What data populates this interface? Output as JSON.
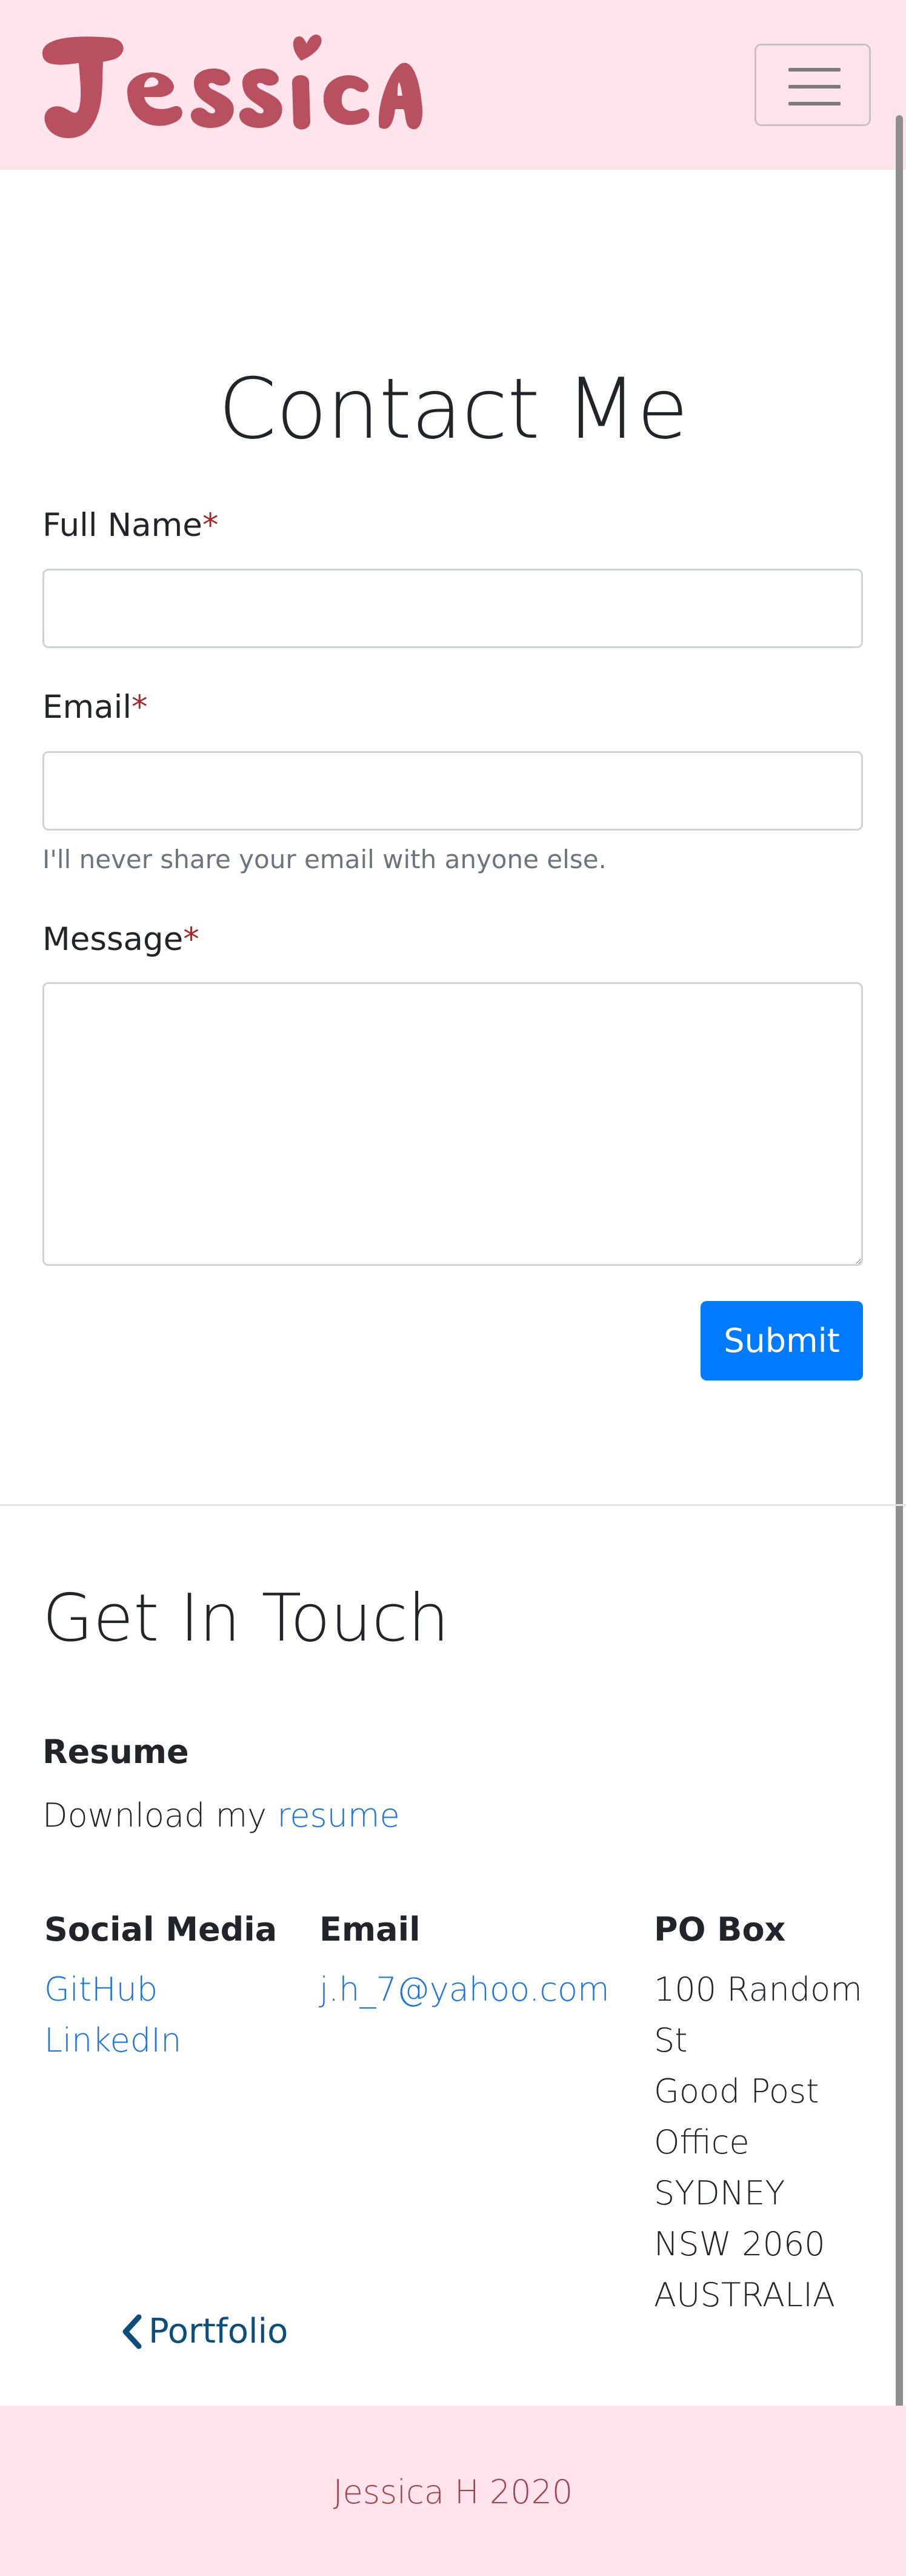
{
  "header": {
    "logo_text": "Jessica",
    "menu_icon": "hamburger-menu-icon"
  },
  "contact": {
    "title": "Contact Me",
    "fields": {
      "full_name_label": "Full Name",
      "full_name_value": "",
      "email_label": "Email",
      "email_value": "",
      "email_help": "I'll never share your email with anyone else.",
      "message_label": "Message",
      "message_value": ""
    },
    "required_mark": "*",
    "submit_label": "Submit"
  },
  "touch": {
    "title": "Get In Touch",
    "resume_heading": "Resume",
    "resume_prefix": "Download my ",
    "resume_link": "resume",
    "social_heading": "Social Media",
    "social_links": [
      "GitHub",
      "LinkedIn"
    ],
    "email_heading": "Email",
    "email_address": "j.h_7@yahoo.com",
    "pobox_heading": "PO Box",
    "pobox_lines": [
      "100 Random",
      "St",
      "Good Post",
      "Office",
      "SYDNEY",
      "NSW 2060",
      "AUSTRALIA"
    ]
  },
  "nav": {
    "portfolio_label": "Portfolio",
    "portfolio_icon": "chevron-left-icon"
  },
  "footer": {
    "text": "Jessica H 2020"
  },
  "colors": {
    "brand_pink_bg": "#ffe4ec",
    "logo": "#b9505f",
    "link": "#1a73e8",
    "button": "#007bff",
    "required": "#a12b2b",
    "footer_text": "#a0424f"
  }
}
